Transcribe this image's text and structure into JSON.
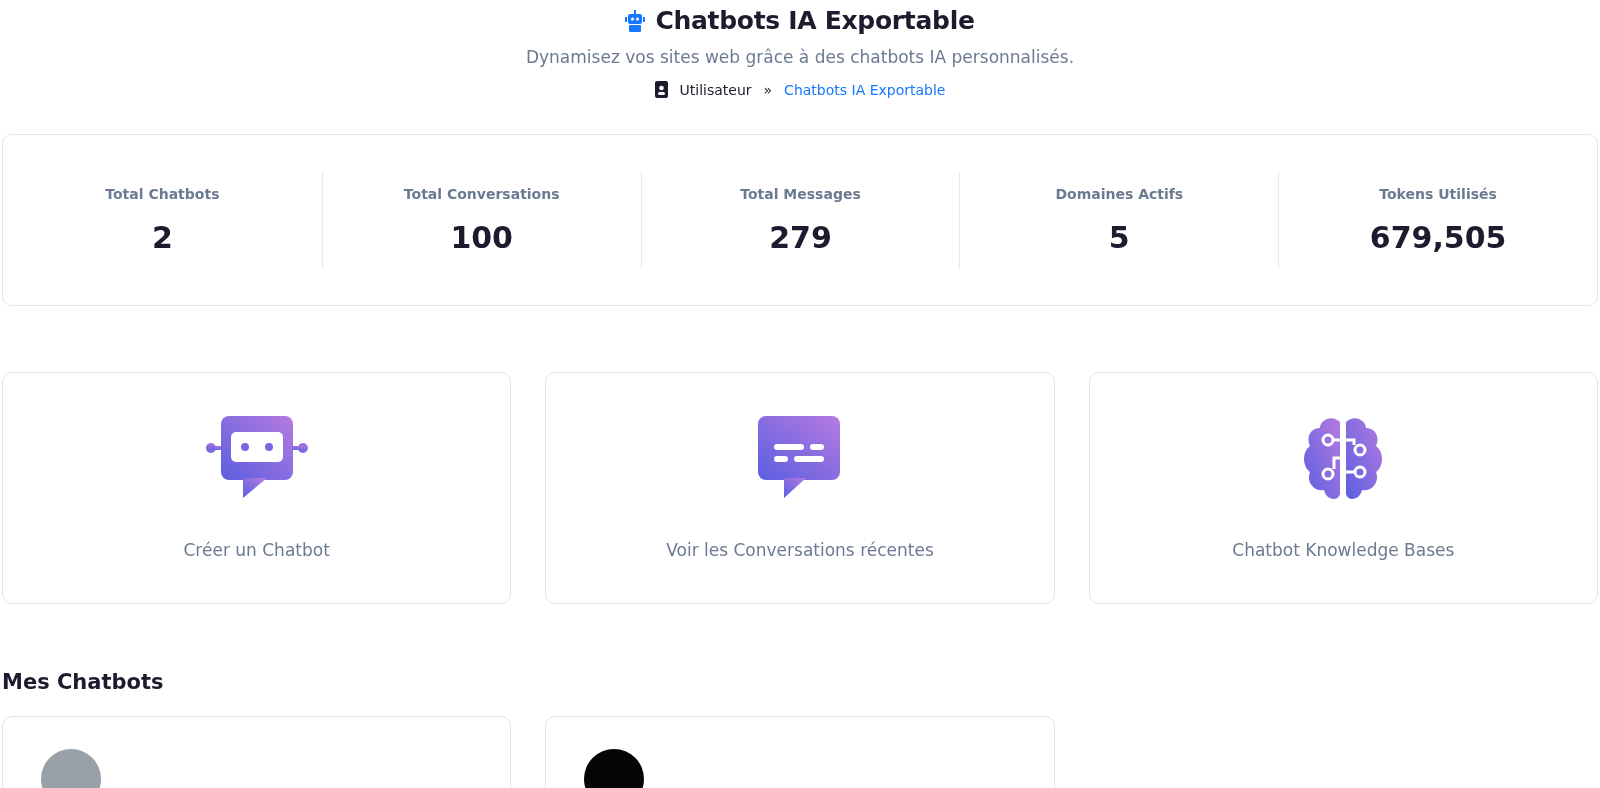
{
  "header": {
    "title": "Chatbots IA Exportable",
    "subtitle": "Dynamisez vos sites web grâce à des chatbots IA personnalisés.",
    "breadcrumb": [
      {
        "label": "Utilisateur",
        "kind": "root"
      },
      {
        "label": "»",
        "kind": "separator"
      },
      {
        "label": "Chatbots IA Exportable",
        "kind": "link"
      }
    ]
  },
  "stats": [
    {
      "label": "Total Chatbots",
      "value": "2"
    },
    {
      "label": "Total Conversations",
      "value": "100"
    },
    {
      "label": "Total Messages",
      "value": "279"
    },
    {
      "label": "Domaines Actifs",
      "value": "5"
    },
    {
      "label": "Tokens Utilisés",
      "value": "679,505"
    }
  ],
  "actions": [
    {
      "kind": "robot",
      "label": "Créer un Chatbot"
    },
    {
      "kind": "chat",
      "label": "Voir les Conversations récentes"
    },
    {
      "kind": "brain",
      "label": "Chatbot Knowledge Bases"
    }
  ],
  "section_title": "Mes Chatbots",
  "chatbots": [
    {
      "kind": "photo"
    },
    {
      "kind": "dark"
    }
  ]
}
